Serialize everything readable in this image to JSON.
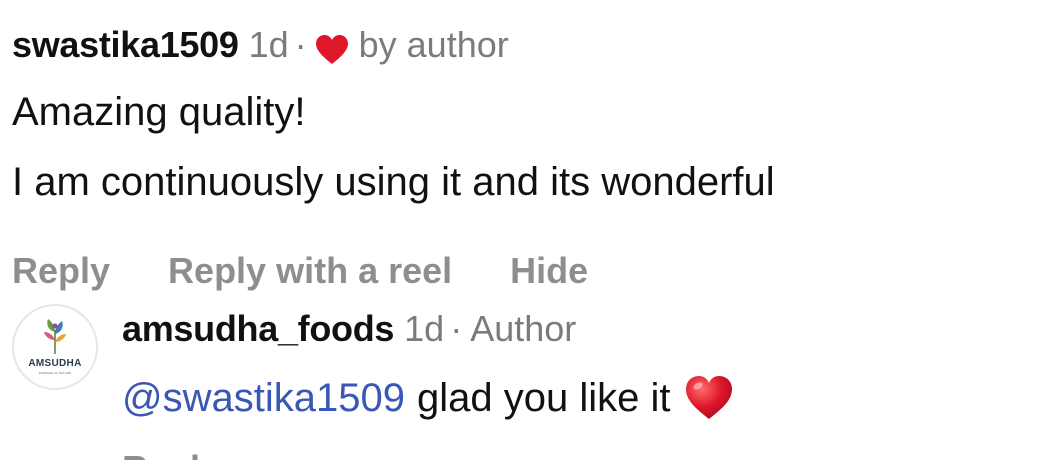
{
  "comment": {
    "username": "swastika1509",
    "time": "1d",
    "separator": "·",
    "liked_by_author_label": "by author",
    "liked_icon": "heart-icon",
    "body_line1": "Amazing quality!",
    "body_line2": "I am continuously using it and its wonderful",
    "actions": {
      "reply": "Reply",
      "reply_with_reel": "Reply with a reel",
      "hide": "Hide"
    }
  },
  "reply": {
    "avatar_brand": "AMSUDHA",
    "avatar_tagline": "ESSENCE OF NATURE",
    "username": "amsudha_foods",
    "time": "1d",
    "separator": "·",
    "role": "Author",
    "mention": "@swastika1509",
    "text": "glad you like it",
    "emoji_icon": "heart-emoji-icon",
    "reply_label_partial": "Reply"
  },
  "colors": {
    "heart": "#e0162b",
    "muted": "#8e8e8e",
    "mention": "#3b57b5",
    "text": "#111111"
  }
}
